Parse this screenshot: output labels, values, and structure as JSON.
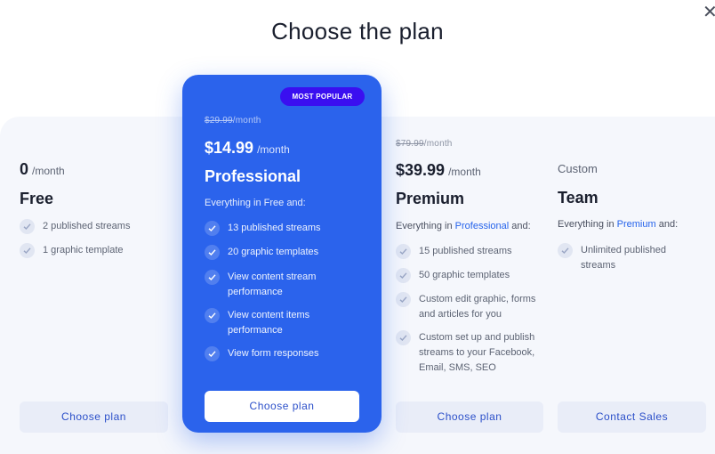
{
  "title": "Choose the plan",
  "close_icon": "close-icon",
  "plans": {
    "free": {
      "price": "0",
      "per": "/month",
      "name": "Free",
      "features": [
        "2 published streams",
        "1 graphic template"
      ],
      "button": "Choose plan"
    },
    "professional": {
      "badge": "MOST POPULAR",
      "old_price": "$29.99",
      "old_per": "/month",
      "price": "$14.99",
      "per": "/month",
      "name": "Professional",
      "intro": "Everything in Free and:",
      "features": [
        "13 published streams",
        "20 graphic templates",
        "View content stream performance",
        "View content items performance",
        "View form responses"
      ],
      "button": "Choose plan"
    },
    "premium": {
      "old_price": "$79.99",
      "old_per": "/month",
      "price": "$39.99",
      "per": "/month",
      "name": "Premium",
      "intro_prefix": "Everything in",
      "intro_link": "Professional",
      "intro_suffix": "and:",
      "features": [
        "15 published streams",
        "50 graphic templates",
        "Custom edit graphic, forms and articles for you",
        "Custom set up and publish streams to your Facebook, Email, SMS, SEO"
      ],
      "button": "Choose plan"
    },
    "team": {
      "custom_label": "Custom",
      "name": "Team",
      "intro_prefix": "Everything in",
      "intro_link": "Premium",
      "intro_suffix": "and:",
      "features": [
        "Unlimited published streams"
      ],
      "button": "Contact Sales"
    }
  },
  "colors": {
    "accent": "#2b63ec",
    "badge": "#3a0ff0",
    "link": "#2563eb",
    "panel": "#f5f7fc"
  }
}
